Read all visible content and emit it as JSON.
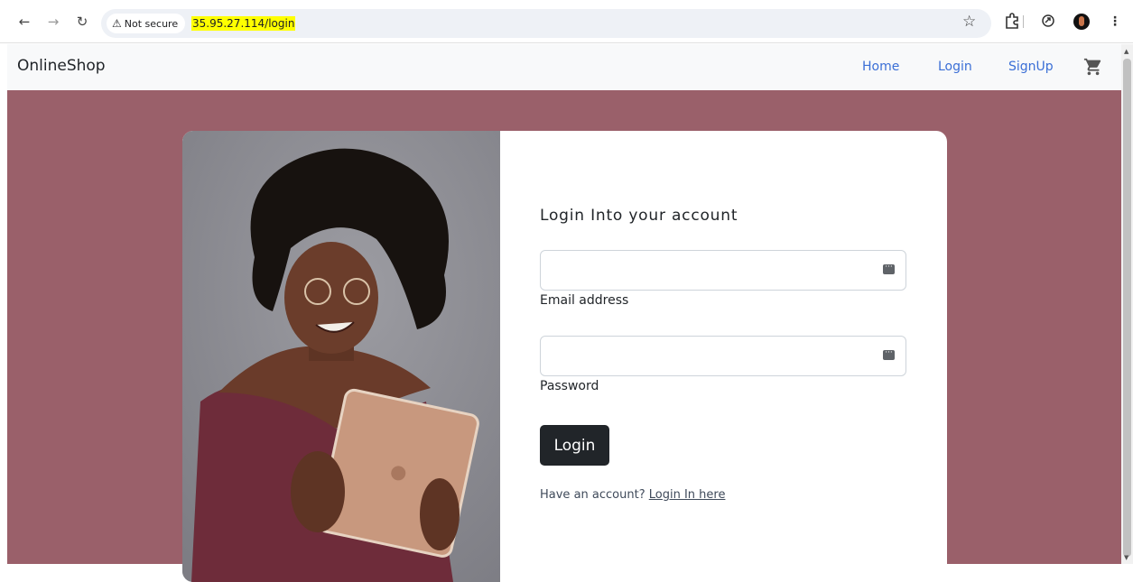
{
  "browser": {
    "security_label": "Not secure",
    "url": "35.95.27.114/login"
  },
  "navbar": {
    "brand": "OnlineShop",
    "links": [
      "Home",
      "Login",
      "SignUp"
    ]
  },
  "form": {
    "title": "Login Into your account",
    "email_label": "Email address",
    "password_label": "Password",
    "submit_label": "Login",
    "have_account_text": "Have an account?",
    "have_account_link": "Login In here"
  },
  "colors": {
    "page_background": "#9a606a",
    "button": "#212529",
    "nav_link": "#3b6fd6"
  },
  "icons": [
    "back-arrow-icon",
    "forward-arrow-icon",
    "reload-icon",
    "warning-icon",
    "bookmark-star-icon",
    "extensions-icon",
    "sync-icon",
    "profile-avatar",
    "shopping-cart-icon",
    "password-key-icon"
  ]
}
